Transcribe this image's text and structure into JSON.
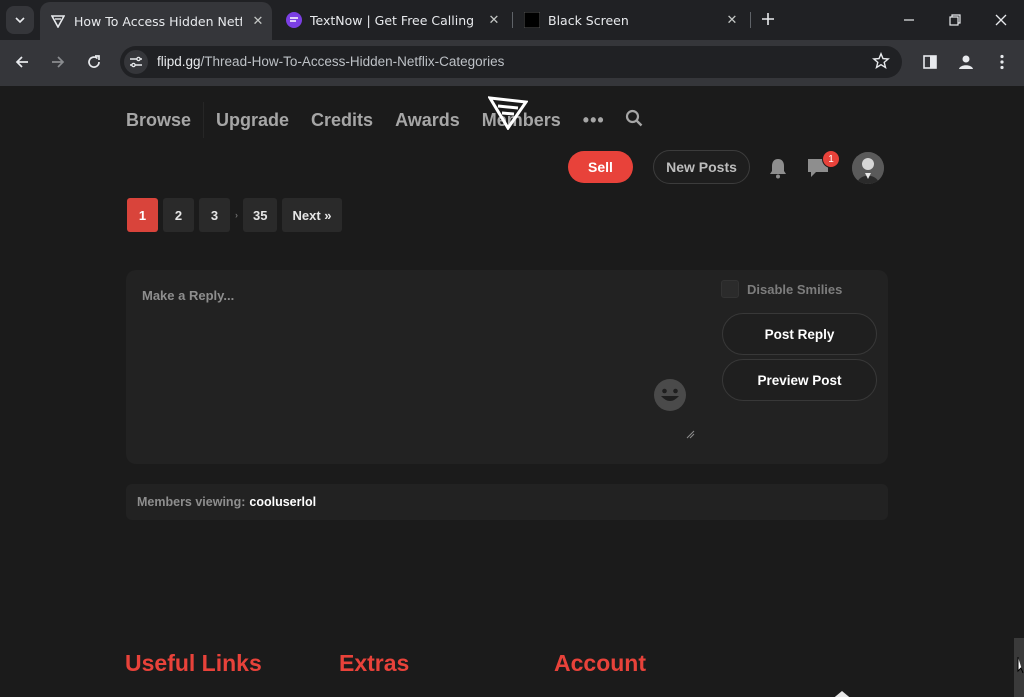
{
  "browser": {
    "tabs": [
      {
        "title": "How To Access Hidden Netflix C",
        "active": true,
        "favicon": "flipd-logo-icon"
      },
      {
        "title": "TextNow | Get Free Calling and",
        "active": false,
        "favicon": "textnow-icon"
      },
      {
        "title": "Black Screen",
        "active": false,
        "favicon": "black-square-icon"
      }
    ],
    "address": {
      "domain": "flipd.gg",
      "path": "/Thread-How-To-Access-Hidden-Netflix-Categories"
    }
  },
  "site": {
    "nav": [
      {
        "label": "Browse"
      },
      {
        "label": "Upgrade"
      },
      {
        "label": "Credits"
      },
      {
        "label": "Awards"
      },
      {
        "label": "Members"
      }
    ],
    "more_label": "•••",
    "sell_label": "Sell",
    "new_posts_label": "New Posts",
    "message_badge": "1",
    "colors": {
      "accent": "#e8423a",
      "background": "#1b1b1b",
      "panel": "#222222"
    }
  },
  "pagination": {
    "pages": [
      "1",
      "2",
      "3"
    ],
    "ellipsis": "›",
    "last": "35",
    "next": "Next »",
    "current": "1"
  },
  "reply": {
    "placeholder": "Make a Reply...",
    "disable_smilies": "Disable Smilies",
    "post_reply": "Post Reply",
    "preview_post": "Preview Post"
  },
  "viewing": {
    "label": "Members viewing:",
    "user": "cooluserlol"
  },
  "footer": {
    "headings": [
      "Useful Links",
      "Extras",
      "Account"
    ]
  }
}
